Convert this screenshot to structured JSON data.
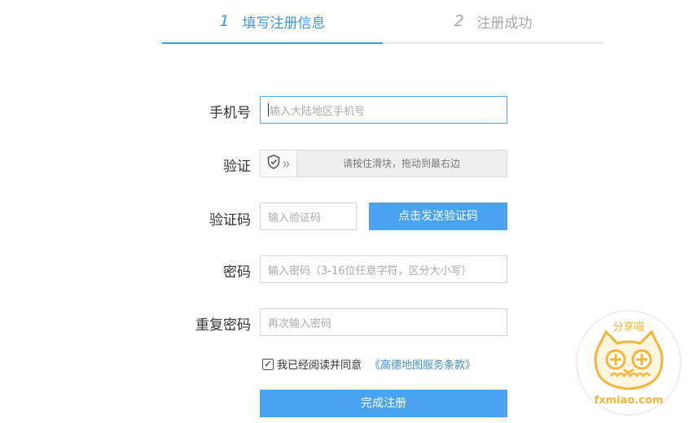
{
  "steps": [
    {
      "num": "1",
      "label": "填写注册信息"
    },
    {
      "num": "2",
      "label": "注册成功"
    }
  ],
  "form": {
    "phone": {
      "label": "手机号",
      "placeholder": "输入大陆地区手机号"
    },
    "verify": {
      "label": "验证",
      "hint": "请按住滑块，拖动到最右边"
    },
    "code": {
      "label": "验证码",
      "placeholder": "输入验证码",
      "send_button": "点击发送验证码"
    },
    "password": {
      "label": "密码",
      "placeholder": "输入密码（3-16位任意字符，区分大小写）"
    },
    "confirm": {
      "label": "重复密码",
      "placeholder": "再次输入密码"
    },
    "agree": {
      "text": "我已经阅读并同意",
      "link": "《高德地图服务条款》",
      "checked": true
    },
    "submit": "完成注册"
  },
  "watermark": {
    "top": "分享喵",
    "bottom": "fxmiao.com"
  },
  "colors": {
    "accent": "#3e97e0",
    "button": "#4aa3f2",
    "muted": "#a8a8a8"
  }
}
